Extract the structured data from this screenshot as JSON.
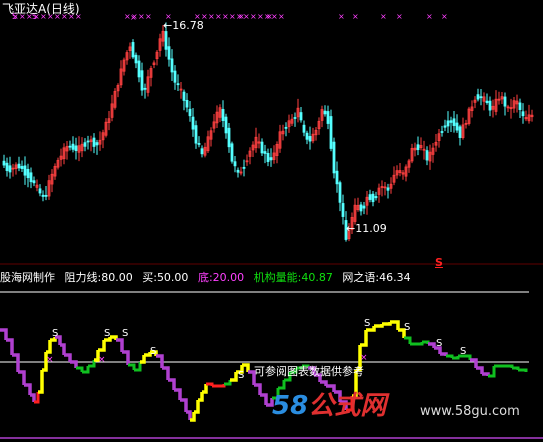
{
  "title": {
    "name": "飞亚达A",
    "period": "(日线)"
  },
  "colors": {
    "background": "#000000",
    "up": "#ff4040",
    "down": "#54ffff",
    "signal_s": "#ff40ff",
    "x_marker": "#ff40ff",
    "yellow": "#ffff00",
    "purple": "#b040d0",
    "green": "#10c020",
    "red": "#ff2020",
    "white": "#ffffff"
  },
  "price_labels": {
    "high": "16.78",
    "low": "11.09"
  },
  "s_marker": "S",
  "indicator": {
    "source": "股海网制作",
    "items": [
      {
        "label": "阻力线",
        "value": "80.00",
        "color": "#ffffff"
      },
      {
        "label": "买",
        "value": "50.00",
        "color": "#ffffff"
      },
      {
        "label": "底",
        "value": "20.00",
        "color": "#ff40ff"
      },
      {
        "label": "机构量能",
        "value": "40.87",
        "color": "#10e010"
      },
      {
        "label": "网之语",
        "value": "46.34",
        "color": "#ffffff"
      }
    ]
  },
  "caption": "可参阅图表数据供参考",
  "watermark": {
    "brand_num": "58",
    "brand_cn": "公式网",
    "url": "www.58gu.com"
  }
}
